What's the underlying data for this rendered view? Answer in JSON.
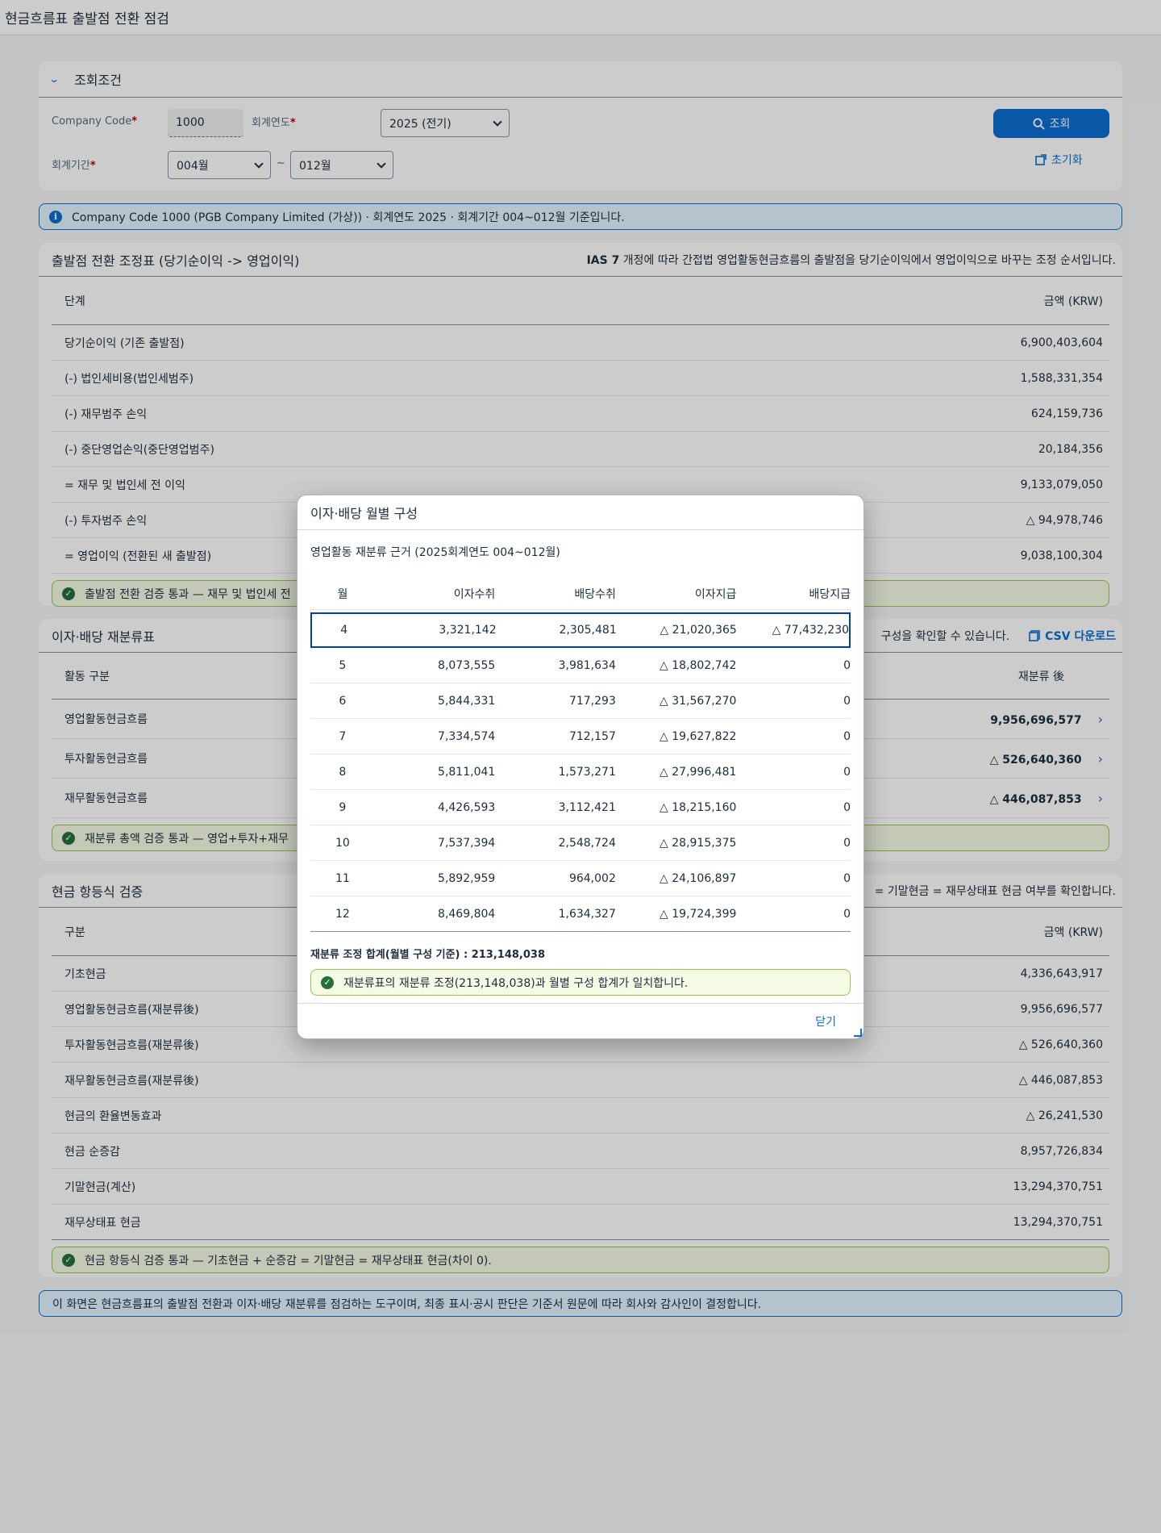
{
  "app_title": "현금흐름표 출발점 전환 점검",
  "filter": {
    "title": "조회조건",
    "company_code_label": "Company Code",
    "company_code_value": "1000",
    "fiscal_year_label": "회계연도",
    "fiscal_year_value": "2025 (전기)",
    "period_label": "회계기간",
    "period_from": "004월",
    "period_sep": "~",
    "period_to": "012월",
    "required_mark": "*",
    "search_button": "조회",
    "reset_button": "초기화"
  },
  "info_message": "Company Code 1000 (PGB Company Limited (가상)) · 회계연도 2025 · 회계기간 004~012월 기준입니다.",
  "bridge": {
    "title": "출발점 전환 조정표 (당기순이익 -> 영업이익)",
    "description_bold": "IAS 7",
    "description": "개정에 따라 간접법 영업활동현금흐름의 출발점을 당기순이익에서 영업이익으로 바꾸는 조정 순서입니다.",
    "columns": [
      "단계",
      "금액 (KRW)"
    ],
    "rows": [
      {
        "label": "당기순이익 (기존 출발점)",
        "value": "6,900,403,604"
      },
      {
        "label": "(-) 법인세비용(법인세범주)",
        "value": "1,588,331,354"
      },
      {
        "label": "(-) 재무범주 손익",
        "value": "624,159,736"
      },
      {
        "label": "(-) 중단영업손익(중단영업범주)",
        "value": "20,184,356"
      },
      {
        "label": "= 재무 및 법인세 전 이익",
        "value": "9,133,079,050"
      },
      {
        "label": "(-) 투자범주 손익",
        "value": "△ 94,978,746"
      },
      {
        "label": "= 영업이익 (전환된 새 출발점)",
        "value": "9,038,100,304"
      }
    ],
    "success_message": "출발점 전환 검증 통과 — 재무 및 법인세 전"
  },
  "reclass": {
    "title": "이자·배당 재분류표",
    "description": "구성을 확인할 수 있습니다.",
    "csv_button": "CSV 다운로드",
    "columns": [
      "활동 구분",
      "재분류 後"
    ],
    "rows": [
      {
        "label": "영업활동현금흐름",
        "value": "9,956,696,577"
      },
      {
        "label": "투자활동현금흐름",
        "value": "△ 526,640,360"
      },
      {
        "label": "재무활동현금흐름",
        "value": "△ 446,087,853"
      }
    ],
    "success_message": "재분류 총액 검증 통과 — 영업+투자+재무"
  },
  "cash_check": {
    "title": "현금 항등식 검증",
    "description": "= 기말현금 = 재무상태표 현금 여부를 확인합니다.",
    "columns": [
      "구분",
      "금액 (KRW)"
    ],
    "rows": [
      {
        "label": "기초현금",
        "value": "4,336,643,917"
      },
      {
        "label": "영업활동현금흐름(재분류後)",
        "value": "9,956,696,577"
      },
      {
        "label": "투자활동현금흐름(재분류後)",
        "value": "△ 526,640,360"
      },
      {
        "label": "재무활동현금흐름(재분류後)",
        "value": "△ 446,087,853"
      },
      {
        "label": "현금의 환율변동효과",
        "value": "△ 26,241,530"
      },
      {
        "label": "현금 순증감",
        "value": "8,957,726,834"
      },
      {
        "label": "기말현금(계산)",
        "value": "13,294,370,751"
      },
      {
        "label": "재무상태표 현금",
        "value": "13,294,370,751"
      }
    ],
    "success_message": "현금 항등식 검증 통과 — 기초현금 + 순증감 = 기말현금 = 재무상태표 현금(차이 0)."
  },
  "footer_note": "이 화면은 현금흐름표의 출발점 전환과 이자·배당 재분류를 점검하는 도구이며, 최종 표시·공시 판단은 기준서 원문에 따라 회사와 감사인이 결정합니다.",
  "dialog": {
    "title": "이자·배당 월별 구성",
    "subtitle": "영업활동 재분류 근거 (2025회계연도 004~012월)",
    "columns": [
      "월",
      "이자수취",
      "배당수취",
      "이자지급",
      "배당지급"
    ],
    "rows": [
      [
        "4",
        "3,321,142",
        "2,305,481",
        "△ 21,020,365",
        "△ 77,432,230"
      ],
      [
        "5",
        "8,073,555",
        "3,981,634",
        "△ 18,802,742",
        "0"
      ],
      [
        "6",
        "5,844,331",
        "717,293",
        "△ 31,567,270",
        "0"
      ],
      [
        "7",
        "7,334,574",
        "712,157",
        "△ 19,627,822",
        "0"
      ],
      [
        "8",
        "5,811,041",
        "1,573,271",
        "△ 27,996,481",
        "0"
      ],
      [
        "9",
        "4,426,593",
        "3,112,421",
        "△ 18,215,160",
        "0"
      ],
      [
        "10",
        "7,537,394",
        "2,548,724",
        "△ 28,915,375",
        "0"
      ],
      [
        "11",
        "5,892,959",
        "964,002",
        "△ 24,106,897",
        "0"
      ],
      [
        "12",
        "8,469,804",
        "1,634,327",
        "△ 19,724,399",
        "0"
      ]
    ],
    "total_label": "재분류 조정 합계(월별 구성 기준) : 213,148,038",
    "success_message": "재분류표의 재분류 조정(213,148,038)과 월별 구성 합계가 일치합니다.",
    "close_button": "닫기"
  }
}
